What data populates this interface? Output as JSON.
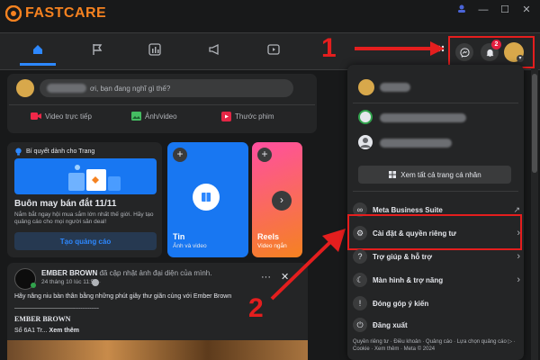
{
  "app": {
    "brand": "FASTCARE"
  },
  "composer": {
    "prompt": "ơi, bạn đang nghĩ gì thế?",
    "actions": [
      "Video trực tiếp",
      "Ảnh/video",
      "Thước phim"
    ]
  },
  "ad": {
    "header": "Bí quyết dành cho Trang",
    "title": "Buôn may bán đắt 11/11",
    "body": "Nắm bắt ngay hội mua sắm lớn nhất thế giới. Hãy tạo quảng cáo cho mọi người săn deal!",
    "button": "Tạo quảng cáo"
  },
  "stories": [
    {
      "title": "Tin",
      "subtitle": "Ảnh và video"
    },
    {
      "title": "Reels",
      "subtitle": "Video ngắn"
    }
  ],
  "post": {
    "author": "EMBER BROWN",
    "action": "đã cập nhật ảnh đại diện của mình.",
    "time": "24 tháng 10 lúc 11:59 ·",
    "text": "Hãy nâng niu bàn thân bằng những phút giây thư giãn cùng với Ember Brown",
    "divider": "-----------------------------------------------",
    "name": "EMBER BROWN",
    "address": "Số 6A1 Tr...",
    "more": "Xem thêm"
  },
  "menu": {
    "see_all_profiles": "Xem tất cả trang cá nhân",
    "items": [
      {
        "label": "Meta Business Suite",
        "icon": "meta-icon"
      },
      {
        "label": "Cài đặt & quyền riêng tư",
        "icon": "gear-icon"
      },
      {
        "label": "Trợ giúp & hỗ trợ",
        "icon": "help-icon"
      },
      {
        "label": "Màn hình & trợ năng",
        "icon": "moon-icon"
      },
      {
        "label": "Đóng góp ý kiến",
        "icon": "feedback-icon"
      },
      {
        "label": "Đăng xuất",
        "icon": "logout-icon"
      }
    ],
    "footer": "Quyền riêng tư · Điều khoản · Quảng cáo · Lựa chọn quảng cáo ▷ · Cookie · Xem thêm · Meta © 2024"
  },
  "header": {
    "notification_count": "2"
  },
  "annotations": {
    "step1": "1",
    "step2": "2"
  },
  "colors": {
    "accent": "#2d88ff",
    "brand": "#f58220",
    "annotation": "#e41e1e"
  }
}
